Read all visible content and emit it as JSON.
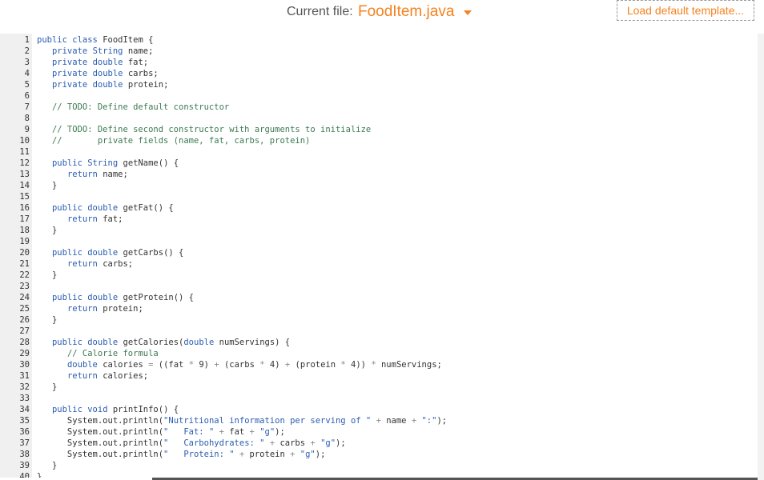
{
  "header": {
    "current_file_label": "Current file:",
    "file_name": "FoodItem.java",
    "load_button_label": "Load default template..."
  },
  "colors": {
    "accent": "#f5821f",
    "keyword": "#2a5db0",
    "comment": "#3d7a52",
    "gutter": "#f0f0f0"
  },
  "editor": {
    "lines": [
      [
        [
          "k",
          "public"
        ],
        [
          "t",
          " "
        ],
        [
          "k",
          "class"
        ],
        [
          "t",
          " FoodItem {"
        ]
      ],
      [
        [
          "t",
          "   "
        ],
        [
          "k",
          "private"
        ],
        [
          "t",
          " "
        ],
        [
          "k",
          "String"
        ],
        [
          "t",
          " name;"
        ]
      ],
      [
        [
          "t",
          "   "
        ],
        [
          "k",
          "private"
        ],
        [
          "t",
          " "
        ],
        [
          "k",
          "double"
        ],
        [
          "t",
          " fat;"
        ]
      ],
      [
        [
          "t",
          "   "
        ],
        [
          "k",
          "private"
        ],
        [
          "t",
          " "
        ],
        [
          "k",
          "double"
        ],
        [
          "t",
          " carbs;"
        ]
      ],
      [
        [
          "t",
          "   "
        ],
        [
          "k",
          "private"
        ],
        [
          "t",
          " "
        ],
        [
          "k",
          "double"
        ],
        [
          "t",
          " protein;"
        ]
      ],
      [],
      [
        [
          "t",
          "   "
        ],
        [
          "c",
          "// TODO: Define default constructor"
        ]
      ],
      [],
      [
        [
          "t",
          "   "
        ],
        [
          "c",
          "// TODO: Define second constructor with arguments to initialize"
        ]
      ],
      [
        [
          "t",
          "   "
        ],
        [
          "c",
          "//       private fields (name, fat, carbs, protein)"
        ]
      ],
      [],
      [
        [
          "t",
          "   "
        ],
        [
          "k",
          "public"
        ],
        [
          "t",
          " "
        ],
        [
          "k",
          "String"
        ],
        [
          "t",
          " getName() {"
        ]
      ],
      [
        [
          "t",
          "      "
        ],
        [
          "k",
          "return"
        ],
        [
          "t",
          " name;"
        ]
      ],
      [
        [
          "t",
          "   }"
        ]
      ],
      [],
      [
        [
          "t",
          "   "
        ],
        [
          "k",
          "public"
        ],
        [
          "t",
          " "
        ],
        [
          "k",
          "double"
        ],
        [
          "t",
          " getFat() {"
        ]
      ],
      [
        [
          "t",
          "      "
        ],
        [
          "k",
          "return"
        ],
        [
          "t",
          " fat;"
        ]
      ],
      [
        [
          "t",
          "   }"
        ]
      ],
      [],
      [
        [
          "t",
          "   "
        ],
        [
          "k",
          "public"
        ],
        [
          "t",
          " "
        ],
        [
          "k",
          "double"
        ],
        [
          "t",
          " getCarbs() {"
        ]
      ],
      [
        [
          "t",
          "      "
        ],
        [
          "k",
          "return"
        ],
        [
          "t",
          " carbs;"
        ]
      ],
      [
        [
          "t",
          "   }"
        ]
      ],
      [],
      [
        [
          "t",
          "   "
        ],
        [
          "k",
          "public"
        ],
        [
          "t",
          " "
        ],
        [
          "k",
          "double"
        ],
        [
          "t",
          " getProtein() {"
        ]
      ],
      [
        [
          "t",
          "      "
        ],
        [
          "k",
          "return"
        ],
        [
          "t",
          " protein;"
        ]
      ],
      [
        [
          "t",
          "   }"
        ]
      ],
      [],
      [
        [
          "t",
          "   "
        ],
        [
          "k",
          "public"
        ],
        [
          "t",
          " "
        ],
        [
          "k",
          "double"
        ],
        [
          "t",
          " getCalories("
        ],
        [
          "k",
          "double"
        ],
        [
          "t",
          " numServings) {"
        ]
      ],
      [
        [
          "t",
          "      "
        ],
        [
          "c",
          "// Calorie formula"
        ]
      ],
      [
        [
          "t",
          "      "
        ],
        [
          "k",
          "double"
        ],
        [
          "t",
          " calories "
        ],
        [
          "o",
          "="
        ],
        [
          "t",
          " ((fat "
        ],
        [
          "o",
          "*"
        ],
        [
          "t",
          " 9) "
        ],
        [
          "o",
          "+"
        ],
        [
          "t",
          " (carbs "
        ],
        [
          "o",
          "*"
        ],
        [
          "t",
          " 4) "
        ],
        [
          "o",
          "+"
        ],
        [
          "t",
          " (protein "
        ],
        [
          "o",
          "*"
        ],
        [
          "t",
          " 4)) "
        ],
        [
          "o",
          "*"
        ],
        [
          "t",
          " numServings;"
        ]
      ],
      [
        [
          "t",
          "      "
        ],
        [
          "k",
          "return"
        ],
        [
          "t",
          " calories;"
        ]
      ],
      [
        [
          "t",
          "   }"
        ]
      ],
      [],
      [
        [
          "t",
          "   "
        ],
        [
          "k",
          "public"
        ],
        [
          "t",
          " "
        ],
        [
          "k",
          "void"
        ],
        [
          "t",
          " printInfo() {"
        ]
      ],
      [
        [
          "t",
          "      System.out.println("
        ],
        [
          "s",
          "\"Nutritional information per serving of \""
        ],
        [
          "t",
          " "
        ],
        [
          "o",
          "+"
        ],
        [
          "t",
          " name "
        ],
        [
          "o",
          "+"
        ],
        [
          "t",
          " "
        ],
        [
          "s",
          "\":\""
        ],
        [
          "t",
          ");"
        ]
      ],
      [
        [
          "t",
          "      System.out.println("
        ],
        [
          "s",
          "\"   Fat: \""
        ],
        [
          "t",
          " "
        ],
        [
          "o",
          "+"
        ],
        [
          "t",
          " fat "
        ],
        [
          "o",
          "+"
        ],
        [
          "t",
          " "
        ],
        [
          "s",
          "\"g\""
        ],
        [
          "t",
          ");"
        ]
      ],
      [
        [
          "t",
          "      System.out.println("
        ],
        [
          "s",
          "\"   Carbohydrates: \""
        ],
        [
          "t",
          " "
        ],
        [
          "o",
          "+"
        ],
        [
          "t",
          " carbs "
        ],
        [
          "o",
          "+"
        ],
        [
          "t",
          " "
        ],
        [
          "s",
          "\"g\""
        ],
        [
          "t",
          ");"
        ]
      ],
      [
        [
          "t",
          "      System.out.println("
        ],
        [
          "s",
          "\"   Protein: \""
        ],
        [
          "t",
          " "
        ],
        [
          "o",
          "+"
        ],
        [
          "t",
          " protein "
        ],
        [
          "o",
          "+"
        ],
        [
          "t",
          " "
        ],
        [
          "s",
          "\"g\""
        ],
        [
          "t",
          ");"
        ]
      ],
      [
        [
          "t",
          "   }"
        ]
      ],
      [
        [
          "t",
          "}"
        ]
      ]
    ]
  }
}
